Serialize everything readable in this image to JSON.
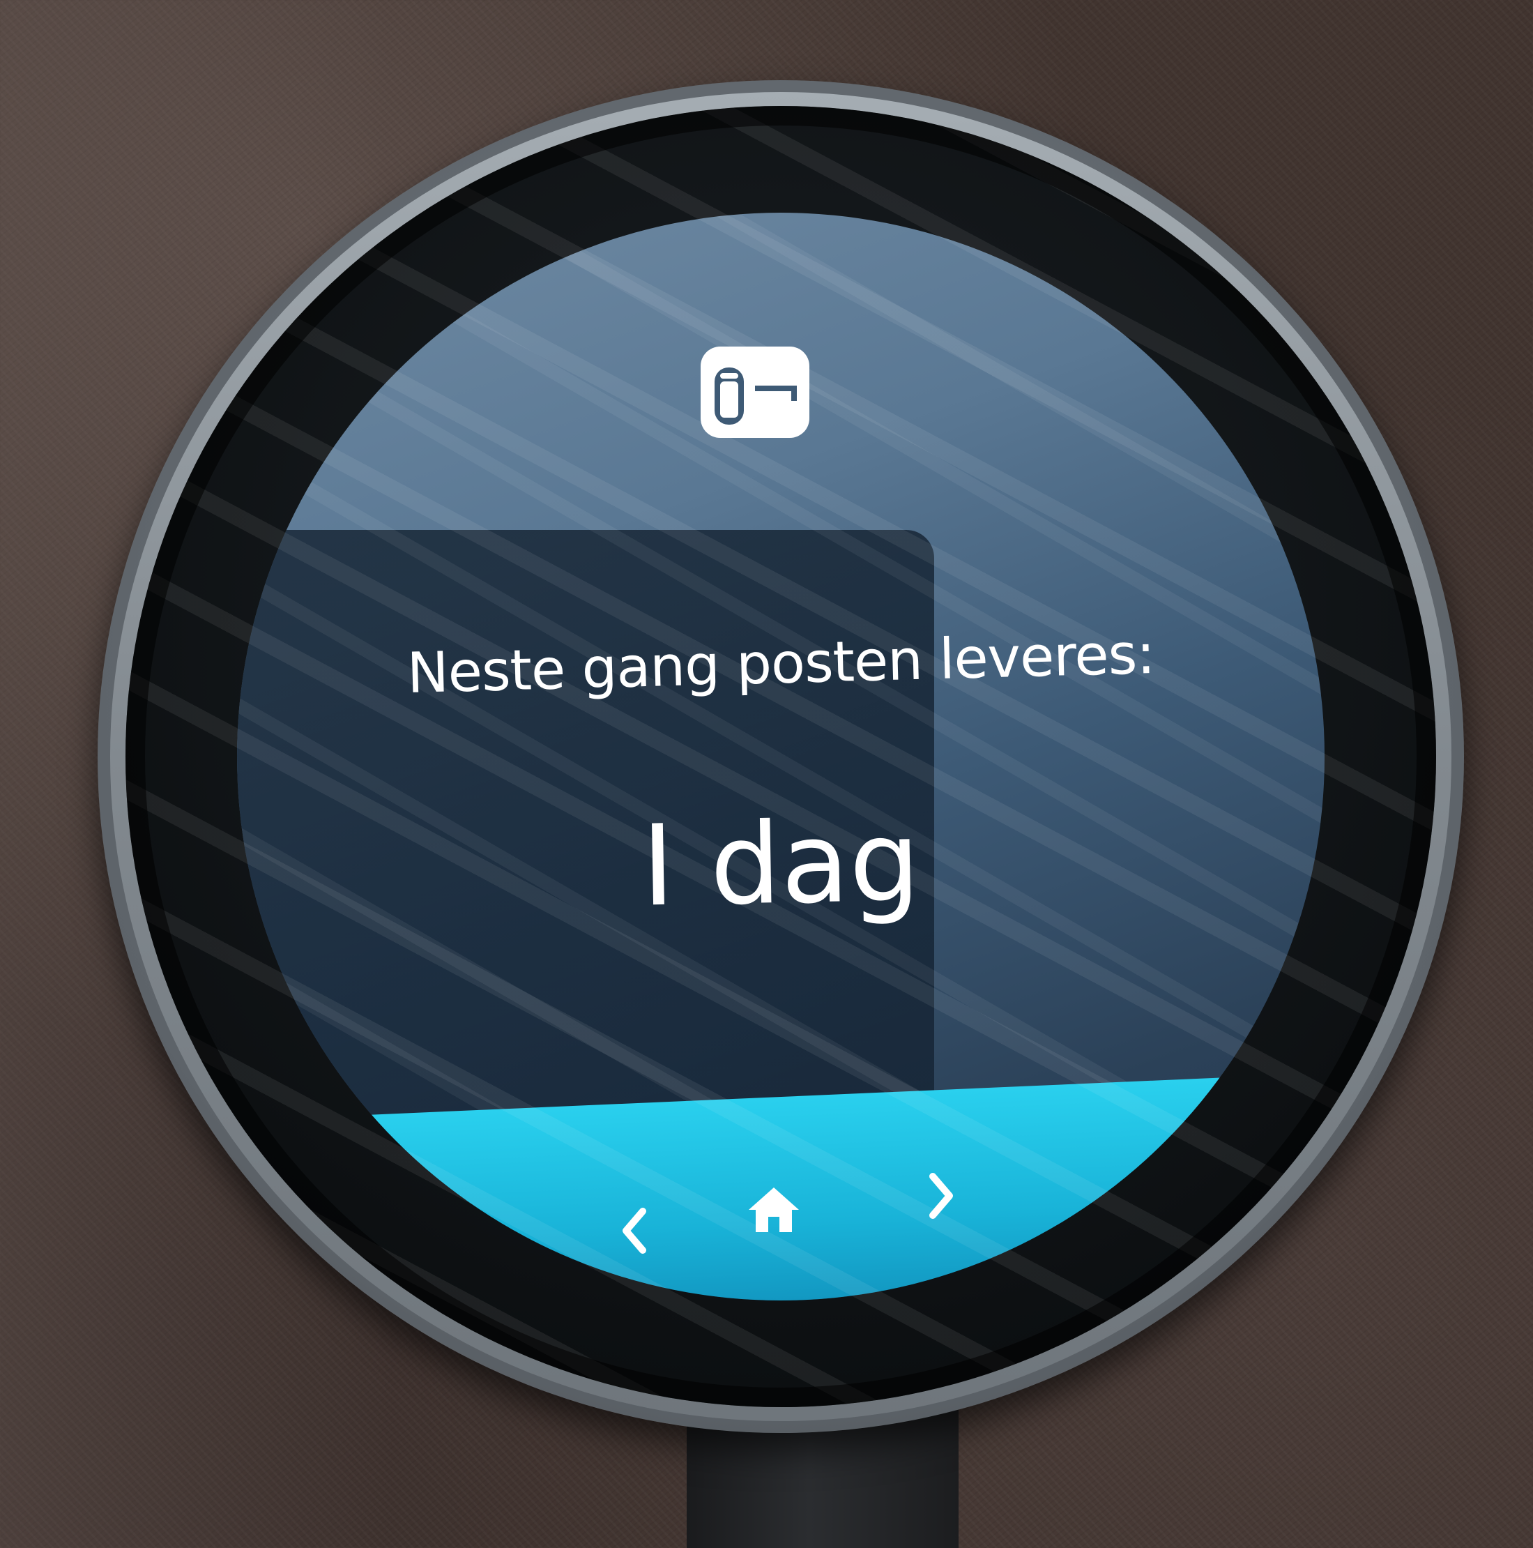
{
  "screen": {
    "label": "Neste gang posten leveres:",
    "value": "I dag"
  },
  "header_icon": "mailbox-icon",
  "nav": {
    "prev_icon": "chevron-left-icon",
    "home_icon": "home-icon",
    "next_icon": "chevron-right-icon"
  },
  "colors": {
    "nav_bar": "#1fc3e6",
    "text": "#ffffff",
    "bezel": "#8a9197"
  }
}
